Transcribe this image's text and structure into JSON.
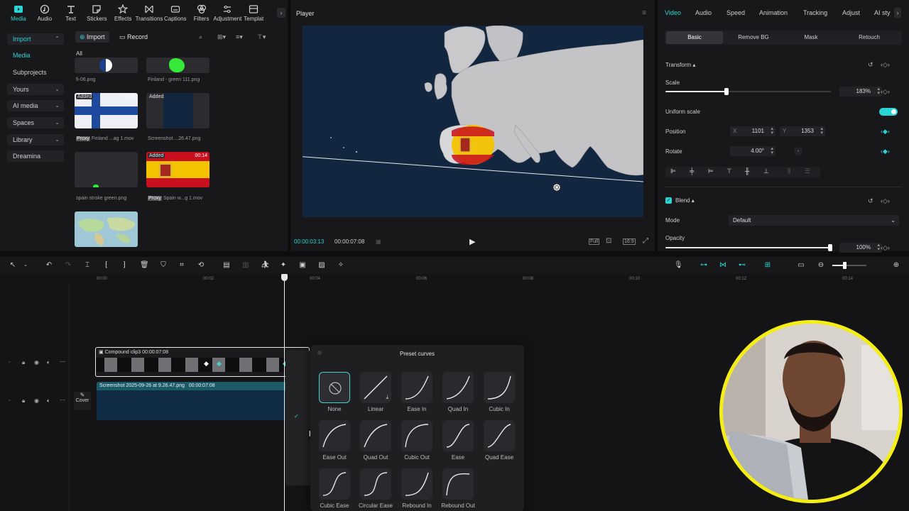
{
  "toolbar": {
    "items": [
      {
        "label": "Media",
        "icon": "media-icon",
        "active": true
      },
      {
        "label": "Audio",
        "icon": "audio-icon"
      },
      {
        "label": "Text",
        "icon": "text-icon"
      },
      {
        "label": "Stickers",
        "icon": "sticker-icon"
      },
      {
        "label": "Effects",
        "icon": "effects-icon"
      },
      {
        "label": "Transitions",
        "icon": "transition-icon"
      },
      {
        "label": "Captions",
        "icon": "captions-icon"
      },
      {
        "label": "Filters",
        "icon": "filter-icon"
      },
      {
        "label": "Adjustment",
        "icon": "adjustment-icon"
      },
      {
        "label": "Templat",
        "icon": "template-icon"
      }
    ]
  },
  "media_sidebar": {
    "items": [
      "Import",
      "Media",
      "Subprojects",
      "Yours",
      "AI media",
      "Spaces",
      "Library",
      "Dreamina"
    ]
  },
  "media_browser": {
    "import_label": "Import",
    "record_label": "Record",
    "filter_all": "All",
    "items": [
      {
        "label": "fi-06.png",
        "badge": ""
      },
      {
        "label": "Finland - green 111.png",
        "badge": ""
      },
      {
        "label": "Finland ...ag 1.mov",
        "badge": "Added",
        "duration": "00:20",
        "proxy": "Proxy"
      },
      {
        "label": "Screenshot....26.47.png",
        "badge": "Added"
      },
      {
        "label": "spain stroke green.png",
        "badge": ""
      },
      {
        "label": "Spain w...g 1.mov",
        "badge": "Added",
        "duration": "00:14",
        "proxy": "Proxy"
      },
      {
        "label": "",
        "badge": ""
      }
    ]
  },
  "player": {
    "title": "Player",
    "current_time": "00:00:03:13",
    "total_time": "00:00:07:08",
    "ratio": "16:9",
    "full_label": "Full"
  },
  "inspector": {
    "tabs": [
      "Video",
      "Audio",
      "Speed",
      "Animation",
      "Tracking",
      "Adjust",
      "AI sty"
    ],
    "subtabs": [
      "Basic",
      "Remove BG",
      "Mask",
      "Retouch"
    ],
    "transform_label": "Transform",
    "scale_label": "Scale",
    "scale_value": "183%",
    "scale_fraction": 0.18,
    "uniform_scale_label": "Uniform scale",
    "position_label": "Position",
    "x_label": "X",
    "x_value": "1101",
    "y_label": "Y",
    "y_value": "1353",
    "rotate_label": "Rotate",
    "rotate_value": "4.00°",
    "blend_label": "Blend",
    "mode_label": "Mode",
    "mode_value": "Default",
    "opacity_label": "Opacity",
    "opacity_value": "100%",
    "opacity_fraction": 1.0
  },
  "timeline": {
    "ruler": [
      "00:00",
      "00:02",
      "00:04",
      "00:06",
      "00:08",
      "00:10",
      "00:12",
      "00:14"
    ],
    "clip1_name": "Compound clip3",
    "clip1_duration": "00:00:07:08",
    "clip2_name": "Screenshot 2025-09-26 at 9.26.47.png",
    "clip2_duration": "00:00:07:08",
    "cover_label": "Cover"
  },
  "preset_curves": {
    "title": "Preset curves",
    "items": [
      "None",
      "Linear",
      "Ease In",
      "Quad In",
      "Cubic In",
      "Ease Out",
      "Quad Out",
      "Cubic Out",
      "Ease",
      "Quad Ease",
      "Cubic Ease",
      "Circular Ease",
      "Rebound In",
      "Rebound Out"
    ]
  },
  "colors": {
    "accent": "#2ad4d4",
    "panel": "#18181b",
    "webcam_border": "#f5ee14",
    "map_sea": "#122640"
  }
}
